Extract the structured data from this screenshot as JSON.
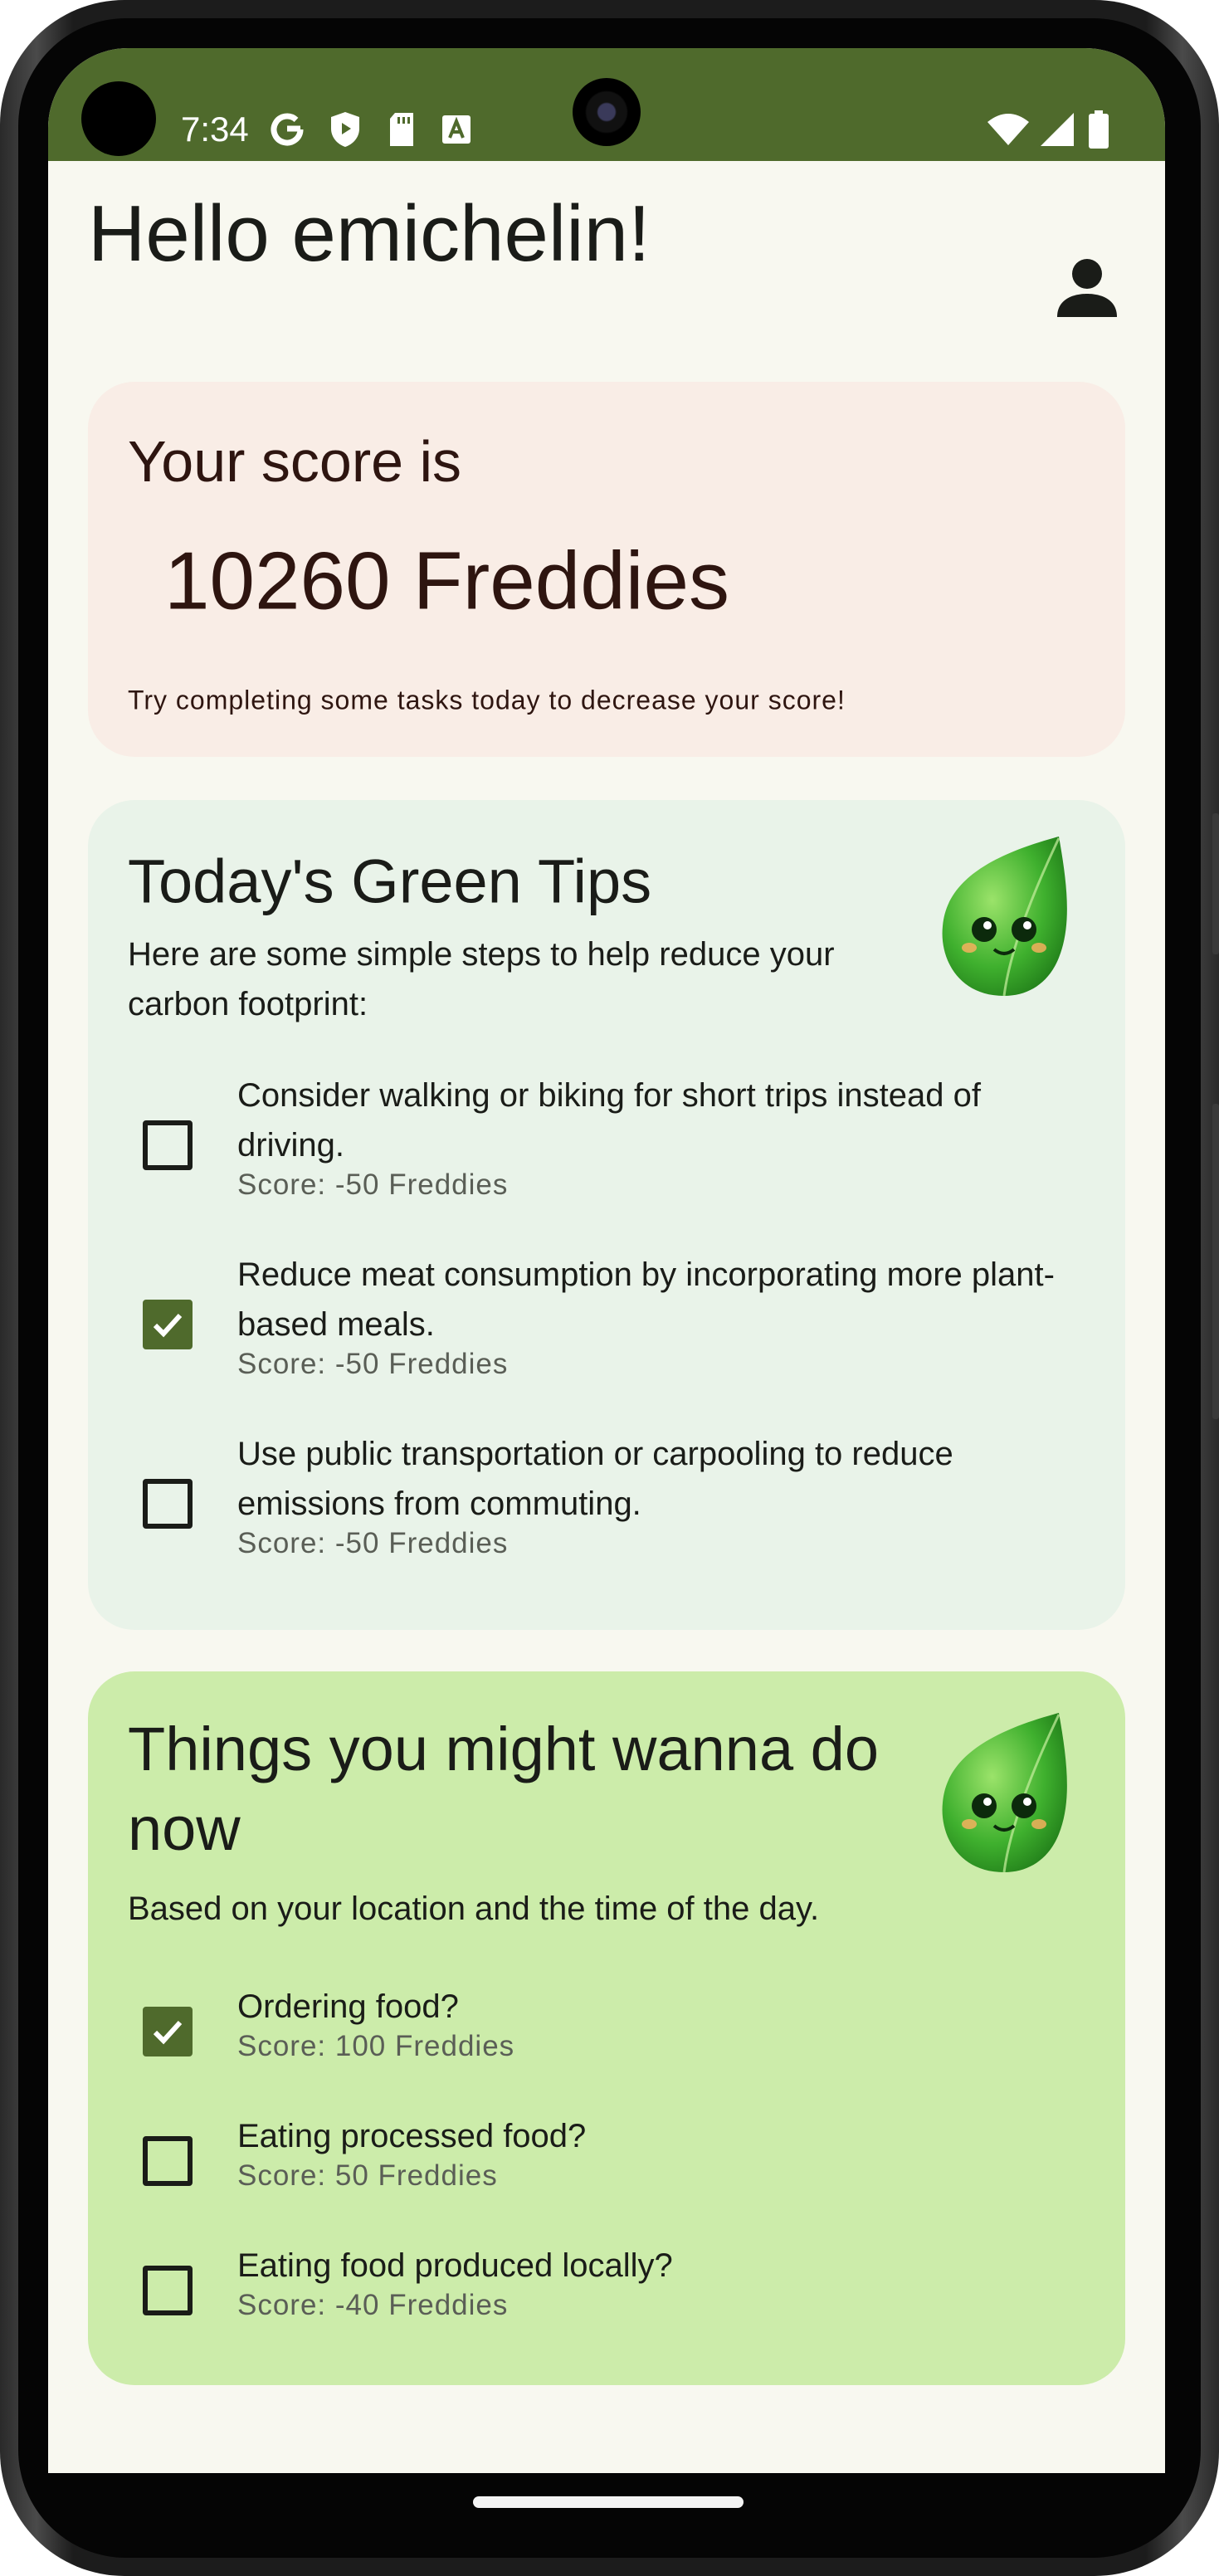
{
  "status_bar": {
    "time": "7:34",
    "icons": [
      "google-icon",
      "shield-play-icon",
      "sd-card-icon",
      "a-box-icon"
    ],
    "right_icons": [
      "wifi-icon",
      "signal-icon",
      "battery-icon"
    ],
    "color": "#4f6a2c"
  },
  "header": {
    "greeting": "Hello emichelin!",
    "profile_icon": "person-icon"
  },
  "score_card": {
    "label": "Your score is",
    "value": "10260 Freddies",
    "hint": "Try completing some tasks today to decrease your score!",
    "color": "#f9ede6"
  },
  "tips_card": {
    "title": "Today's Green Tips",
    "subtitle": "Here are some simple steps to help reduce your carbon footprint:",
    "mascot": "leaf-mascot-icon",
    "color": "#e9f3e9",
    "tasks": [
      {
        "text": "Consider walking or biking for short trips instead of driving.",
        "score": "Score: -50 Freddies",
        "checked": false
      },
      {
        "text": "Reduce meat consumption by incorporating more plant-based meals.",
        "score": "Score: -50 Freddies",
        "checked": true
      },
      {
        "text": "Use public transportation or carpooling to reduce emissions from commuting.",
        "score": "Score: -50 Freddies",
        "checked": false
      }
    ]
  },
  "things_card": {
    "title": "Things you might wanna do now",
    "subtitle": "Based on your location and the time of the day.",
    "mascot": "leaf-mascot-icon",
    "color": "#ccecaa",
    "tasks": [
      {
        "text": "Ordering food?",
        "score": "Score: 100 Freddies",
        "checked": true
      },
      {
        "text": "Eating processed food?",
        "score": "Score: 50 Freddies",
        "checked": false
      },
      {
        "text": "Eating food produced locally?",
        "score": "Score: -40 Freddies",
        "checked": false
      }
    ]
  },
  "accent": "#4f6a2c"
}
